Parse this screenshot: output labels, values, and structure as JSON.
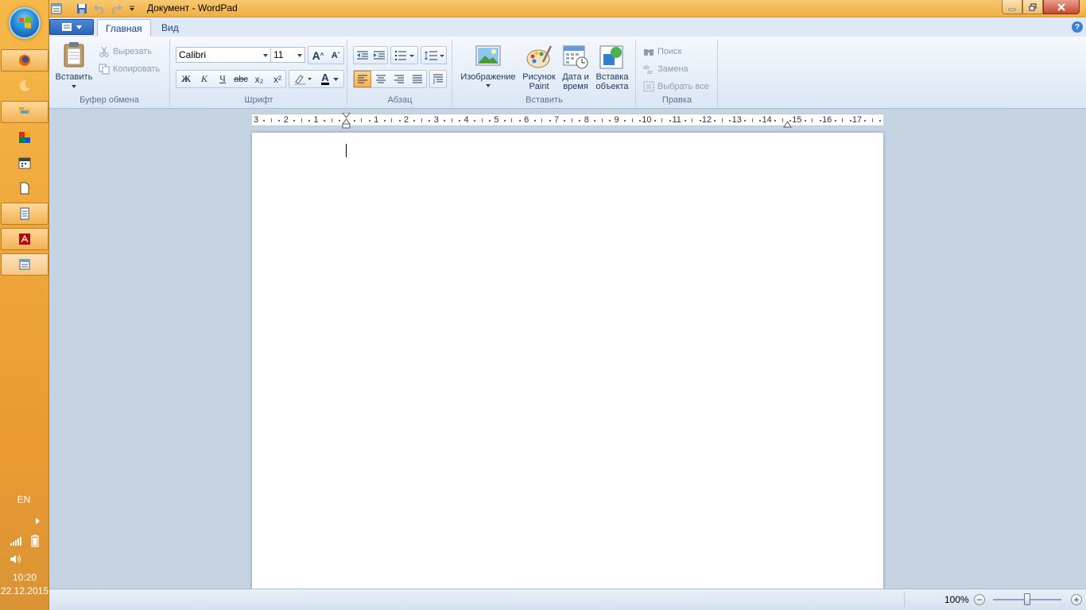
{
  "window": {
    "title": "Документ - WordPad"
  },
  "tabs": {
    "home": "Главная",
    "view": "Вид"
  },
  "clipboard": {
    "paste": "Вставить",
    "cut": "Вырезать",
    "copy": "Копировать",
    "label": "Буфер обмена"
  },
  "font": {
    "family": "Calibri",
    "size": "11",
    "grow": "A",
    "shrink": "A",
    "bold": "Ж",
    "italic": "К",
    "underline": "Ч",
    "strike": "abc",
    "subscript": "x₂",
    "superscript": "x²",
    "color_letter": "A",
    "label": "Шрифт"
  },
  "paragraph": {
    "label": "Абзац"
  },
  "insert": {
    "image": "Изображение",
    "paint_line1": "Рисунок",
    "paint_line2": "Paint",
    "datetime_line1": "Дата и",
    "datetime_line2": "время",
    "object_line1": "Вставка",
    "object_line2": "объекта",
    "label": "Вставить"
  },
  "editing": {
    "find": "Поиск",
    "replace": "Замена",
    "select_all": "Выбрать все",
    "label": "Правка"
  },
  "ruler": {
    "labels": [
      "3",
      "2",
      "1",
      "1",
      "2",
      "3",
      "4",
      "5",
      "6",
      "7",
      "8",
      "9",
      "10",
      "11",
      "12",
      "13",
      "14",
      "15",
      "16",
      "17"
    ]
  },
  "status": {
    "zoom": "100%",
    "zoom_out": "−",
    "zoom_in": "+",
    "zoom_fraction": 0.5
  },
  "tray": {
    "lang": "EN",
    "time": "10:20",
    "date": "22.12.2015"
  },
  "help": "?"
}
